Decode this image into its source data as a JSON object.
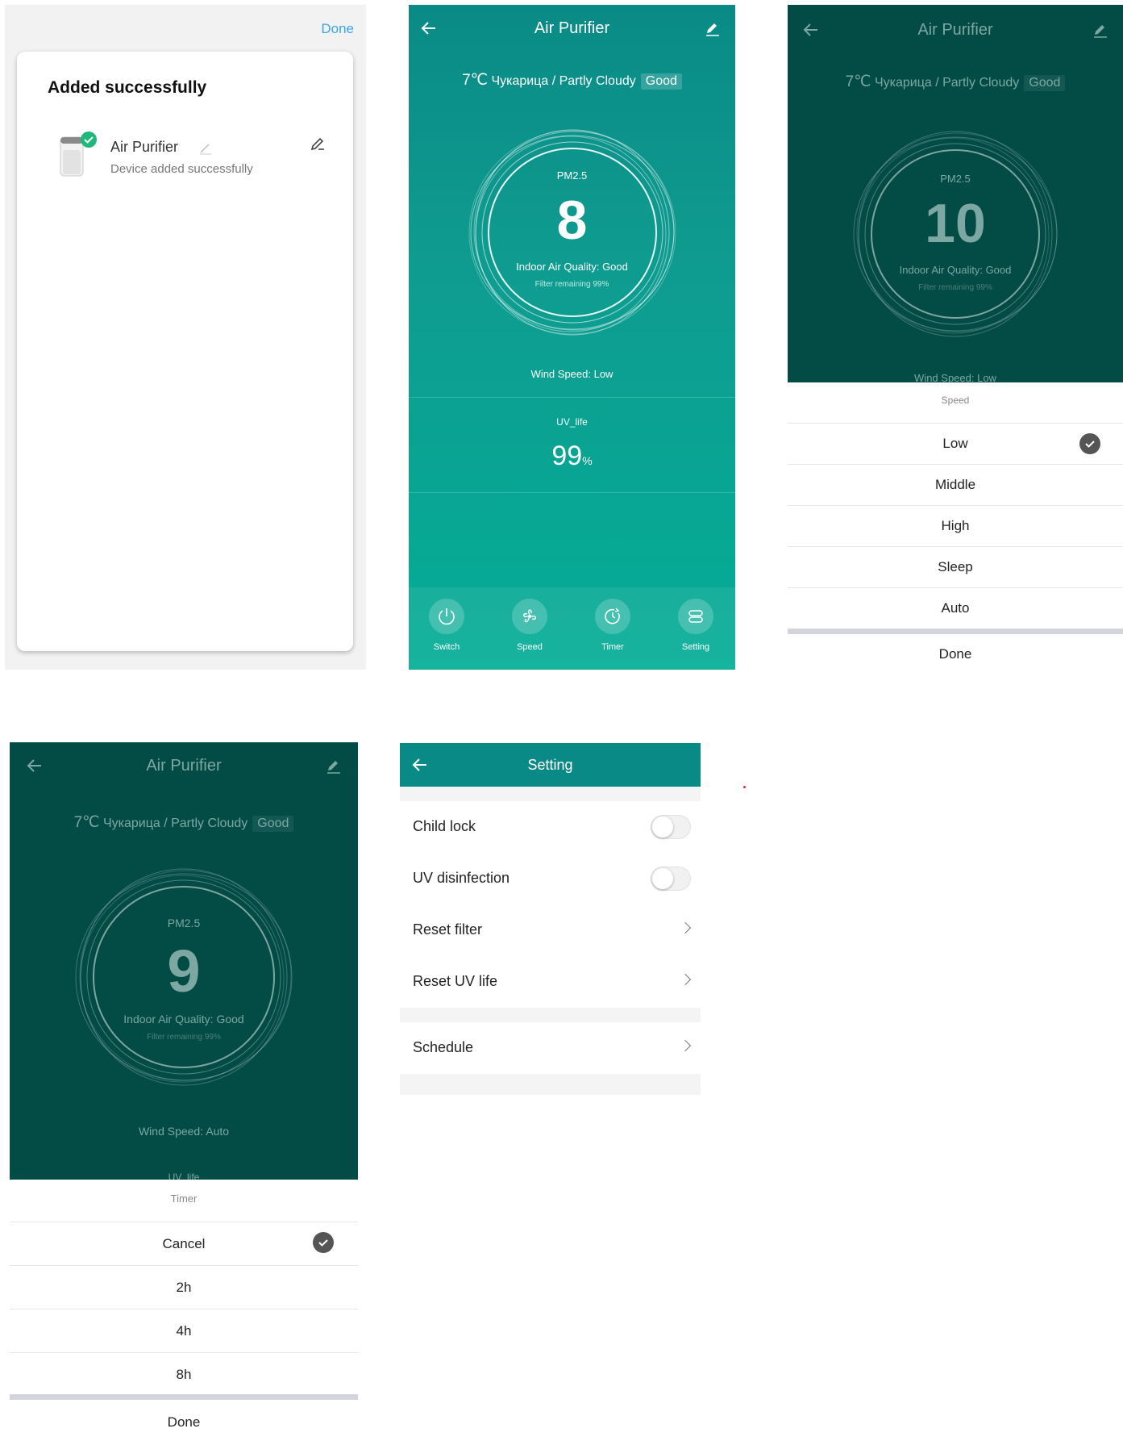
{
  "screen1": {
    "done": "Done",
    "heading": "Added successfully",
    "device_name": "Air Purifier",
    "device_status": "Device added successfully"
  },
  "screen2": {
    "title": "Air Purifier",
    "temp": "7℃",
    "location": "Чукарица / Partly Cloudy",
    "aq_badge": "Good",
    "pm_label": "PM2.5",
    "pm_value": "8",
    "indoor": "Indoor Air Quality: Good",
    "filter": "Filter remaining 99%",
    "wind": "Wind Speed: Low",
    "uv_label": "UV_life",
    "uv_value": "99",
    "uv_unit": "%",
    "tabs": [
      "Switch",
      "Speed",
      "Timer",
      "Setting"
    ]
  },
  "screen3": {
    "title": "Air Purifier",
    "temp": "7℃",
    "location": "Чукарица / Partly Cloudy",
    "aq_badge": "Good",
    "pm_label": "PM2.5",
    "pm_value": "10",
    "indoor": "Indoor Air Quality: Good",
    "filter": "Filter remaining 99%",
    "wind": "Wind Speed: Low",
    "sheet_title": "Speed",
    "options": [
      "Low",
      "Middle",
      "High",
      "Sleep",
      "Auto"
    ],
    "selected": "Low",
    "done": "Done"
  },
  "screen4": {
    "title": "Air Purifier",
    "temp": "7℃",
    "location": "Чукарица / Partly Cloudy",
    "aq_badge": "Good",
    "pm_label": "PM2.5",
    "pm_value": "9",
    "indoor": "Indoor Air Quality: Good",
    "filter": "Filter remaining 99%",
    "wind": "Wind Speed: Auto",
    "uv_partial": "UV_life",
    "sheet_title": "Timer",
    "options": [
      "Cancel",
      "2h",
      "4h",
      "8h"
    ],
    "selected": "Cancel",
    "done": "Done"
  },
  "screen5": {
    "title": "Setting",
    "rows": [
      "Child lock",
      "UV disinfection",
      "Reset filter",
      "Reset UV life",
      "Schedule"
    ],
    "toggles": {
      "child_lock": false,
      "uv_disinfection": false
    }
  },
  "colors": {
    "teal": "#0f9c90",
    "dark_teal": "#024c45",
    "accent_blue": "#3aa6e8",
    "green_check": "#1fb87a"
  }
}
